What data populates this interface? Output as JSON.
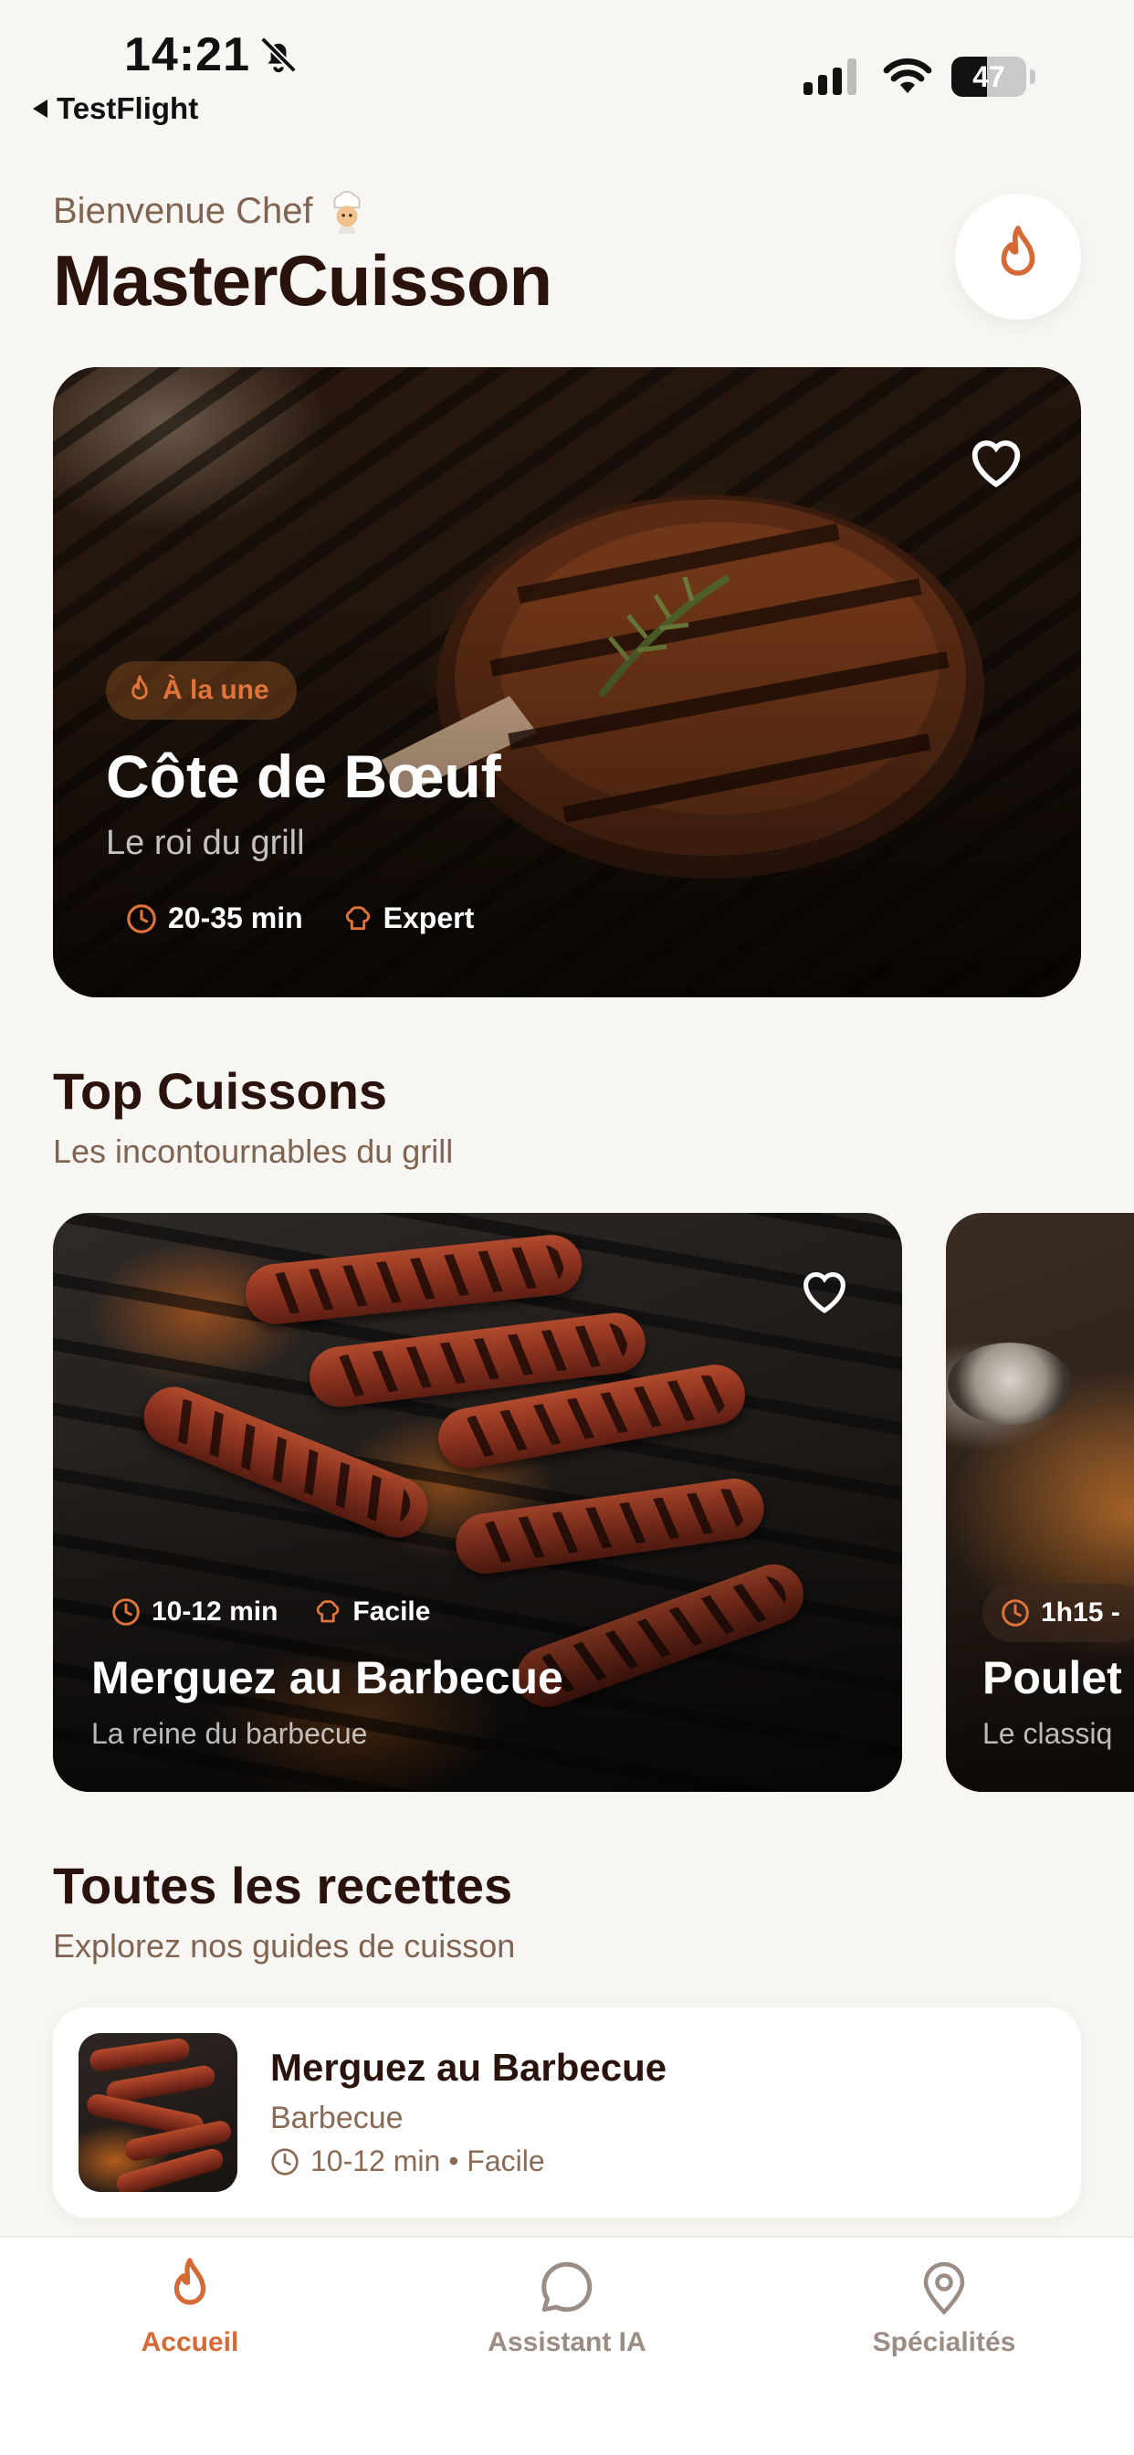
{
  "status_bar": {
    "time": "14:21",
    "back_app": "TestFlight",
    "battery": "47",
    "battery_level": 0.47
  },
  "header": {
    "welcome": "Bienvenue Chef",
    "title": "MasterCuisson"
  },
  "hero": {
    "badge": "À la une",
    "title": "Côte de Bœuf",
    "subtitle": "Le roi du grill",
    "time": "20-35 min",
    "difficulty": "Expert"
  },
  "top_section": {
    "title": "Top Cuissons",
    "subtitle": "Les incontournables du grill",
    "cards": [
      {
        "time": "10-12 min",
        "difficulty": "Facile",
        "title": "Merguez au Barbecue",
        "subtitle": "La reine du barbecue"
      },
      {
        "time": "1h15 -",
        "title": "Poulet",
        "subtitle": "Le classiq"
      }
    ]
  },
  "recipes_section": {
    "title": "Toutes les recettes",
    "subtitle": "Explorez nos guides de cuisson",
    "items": [
      {
        "name": "Merguez au Barbecue",
        "category": "Barbecue",
        "meta": "10-12 min • Facile"
      }
    ]
  },
  "tabs": [
    {
      "label": "Accueil",
      "icon": "flame-icon",
      "active": true
    },
    {
      "label": "Assistant IA",
      "icon": "chat-bubble-icon",
      "active": false
    },
    {
      "label": "Spécialités",
      "icon": "map-pin-icon",
      "active": false
    }
  ],
  "colors": {
    "accent": "#d56a36",
    "background": "#f8f6f2",
    "title": "#2a130c",
    "muted": "#806452"
  }
}
